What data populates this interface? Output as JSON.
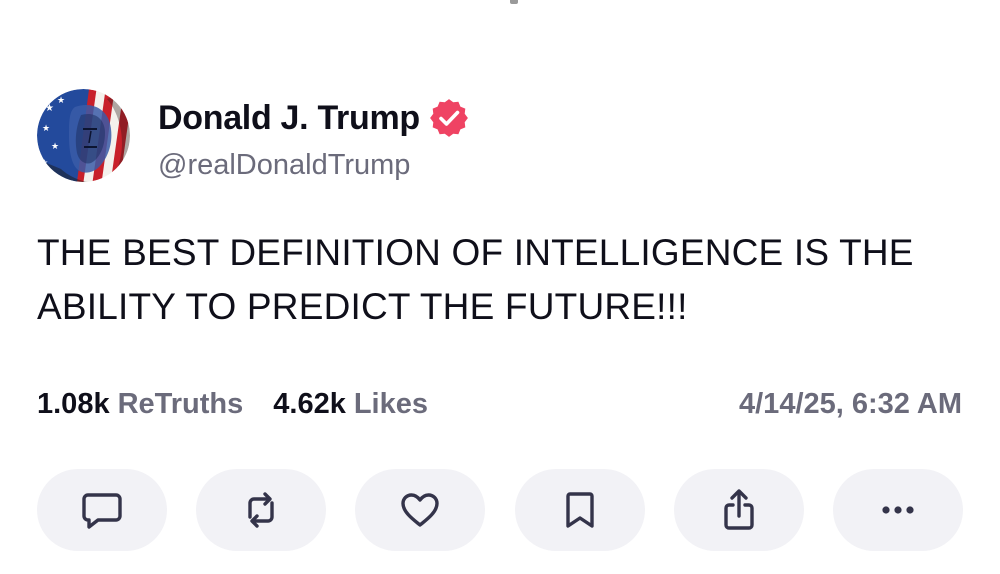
{
  "post": {
    "author": {
      "display_name": "Donald J. Trump",
      "handle": "@realDonaldTrump",
      "verified": true,
      "verified_color": "#ef4363"
    },
    "text": "THE BEST DEFINITION OF INTELLIGENCE IS THE ABILITY TO PREDICT THE FUTURE!!!",
    "stats": {
      "retruths_count": "1.08k",
      "retruths_label": "ReTruths",
      "likes_count": "4.62k",
      "likes_label": "Likes"
    },
    "timestamp": "4/14/25, 6:32 AM"
  },
  "actions": [
    {
      "icon": "comment-icon"
    },
    {
      "icon": "retruth-icon"
    },
    {
      "icon": "heart-icon"
    },
    {
      "icon": "bookmark-icon"
    },
    {
      "icon": "share-icon"
    },
    {
      "icon": "more-icon"
    }
  ],
  "colors": {
    "text_primary": "#0f0f1a",
    "text_secondary": "#6b6b7b",
    "button_bg": "#f2f2f6",
    "icon": "#34344a",
    "accent": "#ef4363"
  }
}
